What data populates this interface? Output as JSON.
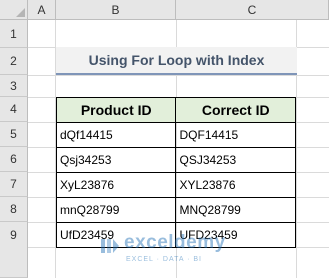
{
  "spreadsheet": {
    "columns": [
      "A",
      "B",
      "C"
    ],
    "rows": [
      "1",
      "2",
      "3",
      "4",
      "5",
      "6",
      "7",
      "8",
      "9"
    ],
    "title": "Using For Loop with Index",
    "table": {
      "headers": [
        "Product ID",
        "Correct ID"
      ],
      "rows": [
        [
          "dQf14415",
          "DQF14415"
        ],
        [
          "Qsj34253",
          "QSJ34253"
        ],
        [
          "XyL23876",
          "XYL23876"
        ],
        [
          "mnQ28799",
          "MNQ28799"
        ],
        [
          "UfD23459",
          "UFD23459"
        ]
      ]
    }
  },
  "watermark": {
    "name": "exceldemy",
    "tagline": "EXCEL · DATA · BI"
  },
  "colors": {
    "header_fill": "#e2efda",
    "title_fill": "#f2f2f2",
    "title_text": "#44546a",
    "title_underline": "#7f95b8",
    "watermark": "#1f6fb5"
  }
}
